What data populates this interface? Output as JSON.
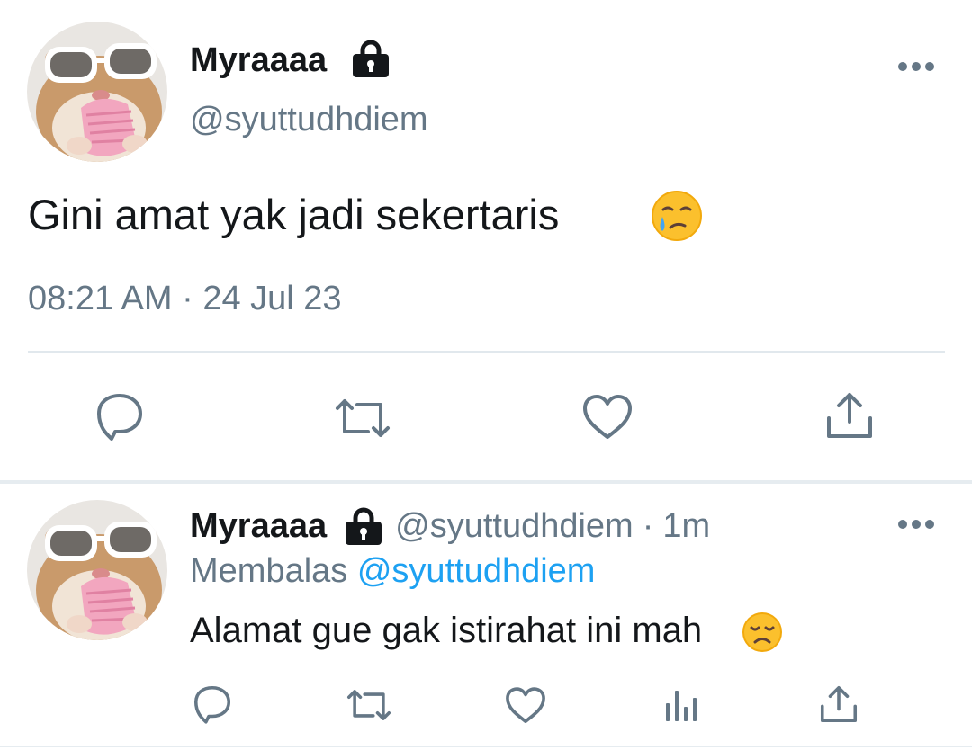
{
  "main_tweet": {
    "display_name": "Myraaaa",
    "handle": "@syuttudhdiem",
    "text": "Gini amat yak jadi sekertaris",
    "text_emoji": "face-holding-back-tears",
    "timestamp": "08:21 AM · 24 Jul 23",
    "actions": [
      "reply-icon",
      "retweet-icon",
      "like-icon",
      "share-icon"
    ]
  },
  "reply": {
    "display_name": "Myraaaa",
    "handle": "@syuttudhdiem",
    "separator": "·",
    "time": "1m",
    "replying_label": "Membalas",
    "replying_to": "@syuttudhdiem",
    "text": "Alamat gue gak istirahat ini mah",
    "text_emoji": "disappointed-face",
    "actions": [
      "reply-icon",
      "retweet-icon",
      "like-icon",
      "analytics-icon",
      "share-icon"
    ]
  },
  "colors": {
    "primary_text": "#14171a",
    "secondary_text": "#657786",
    "link": "#1da1f2",
    "divider": "#e1e8ed",
    "emoji_yellow": "#fbc02d"
  }
}
